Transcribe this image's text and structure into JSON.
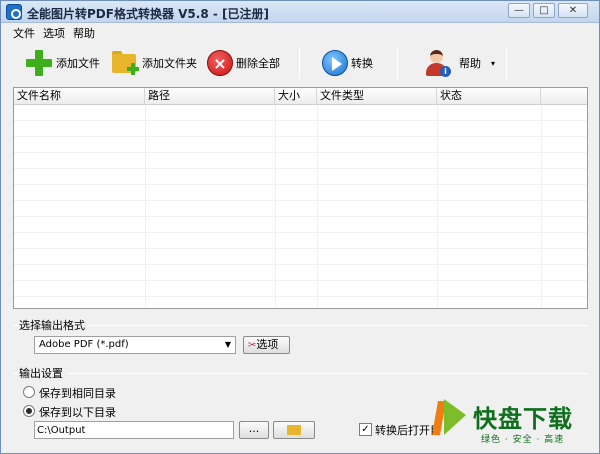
{
  "window": {
    "title": "全能图片转PDF格式转换器 V5.8 - [已注册]",
    "minimize_label": "—",
    "maximize_label": "□",
    "close_label": "✕"
  },
  "menu": [
    "文件",
    "选项",
    "帮助"
  ],
  "toolbar": {
    "add_file": "添加文件",
    "add_folder": "添加文件夹",
    "delete_all": "删除全部",
    "convert": "转换",
    "help": "帮助",
    "help_dropdown": "▾"
  },
  "file_list": {
    "columns": [
      "文件名称",
      "路径",
      "大小",
      "文件类型",
      "状态"
    ],
    "rows": []
  },
  "output_format": {
    "group_label": "选择输出格式",
    "selected": "Adobe PDF (*.pdf)",
    "options_button": "选项"
  },
  "output_settings": {
    "group_label": "输出设置",
    "radio_same_dir": "保存到相同目录",
    "radio_custom_dir": "保存到以下目录",
    "selected_radio": "custom",
    "path_value": "C:\\Output",
    "browse_button": "...",
    "open_after_label": "转换后打开目",
    "open_after_checked": true,
    "check_mark": "✓"
  },
  "watermark": {
    "title": "快盘下载",
    "subtitle": "绿色 · 安全 · 高速"
  }
}
